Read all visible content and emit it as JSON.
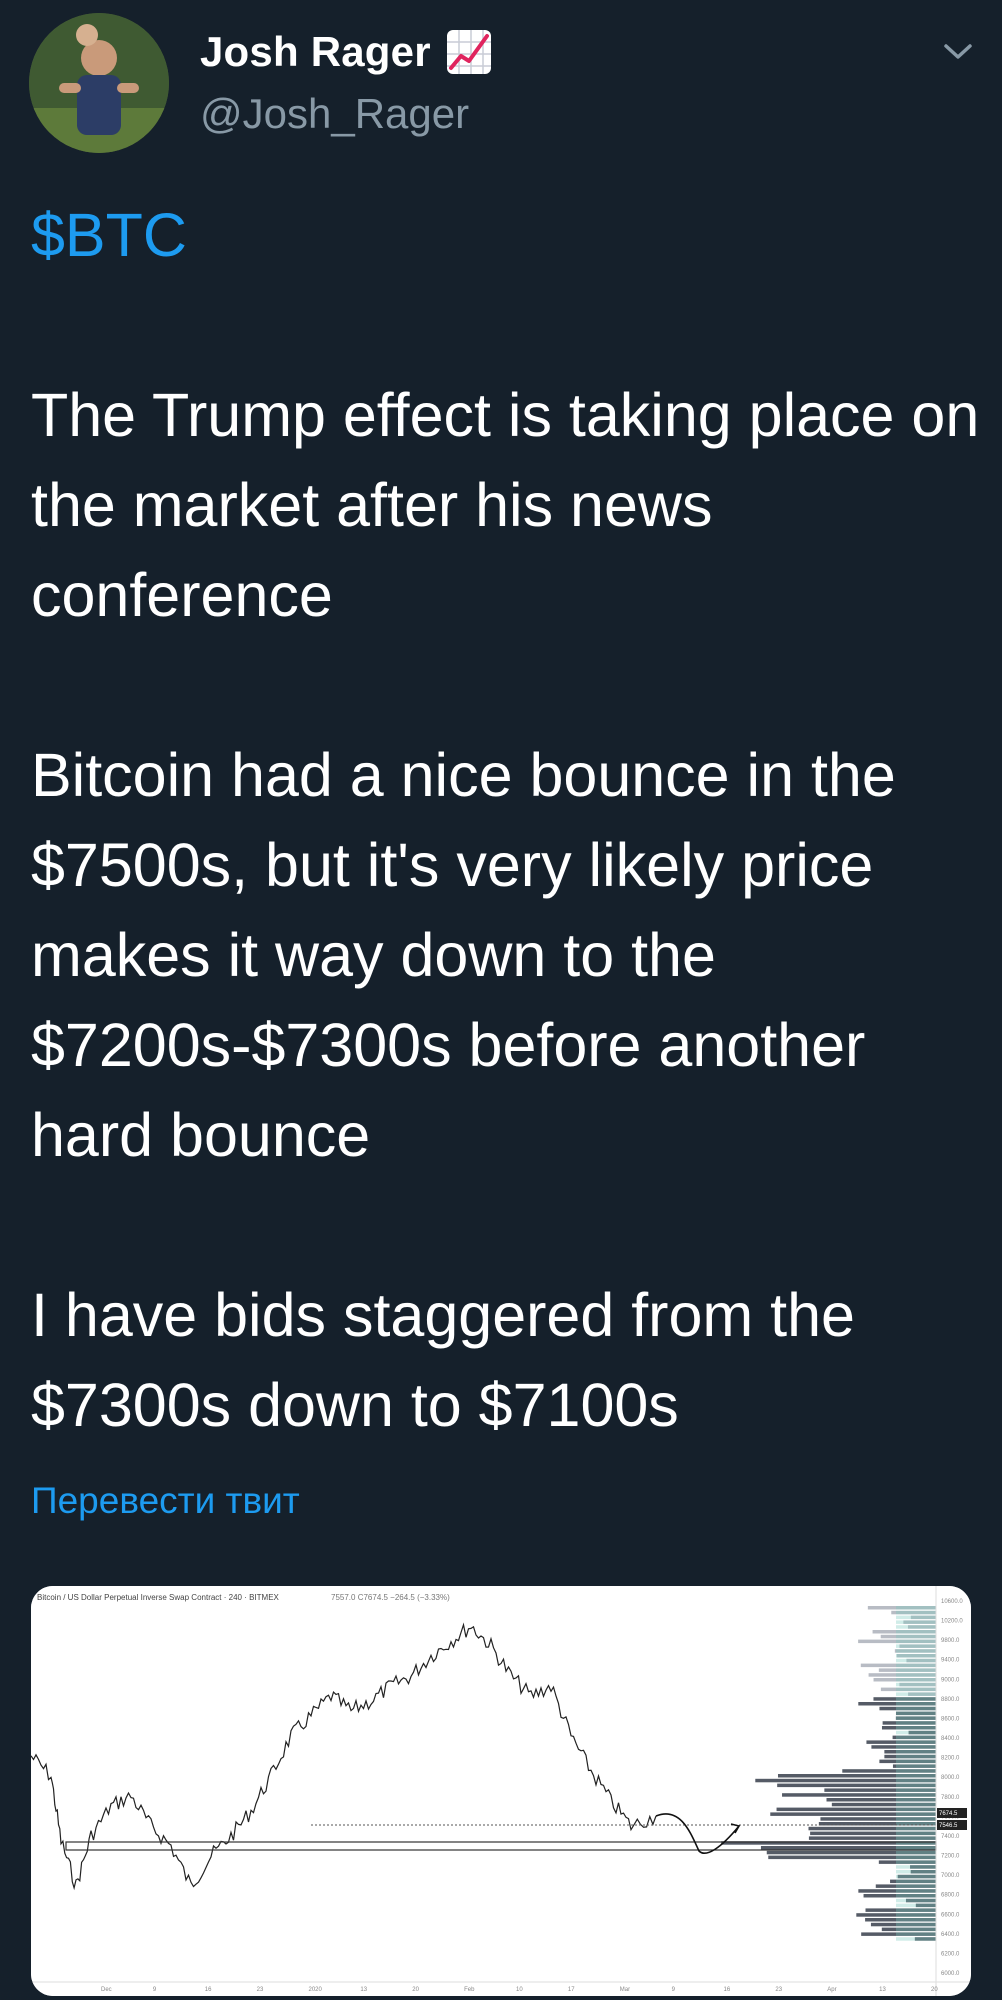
{
  "author": {
    "name": "Josh Rager",
    "handle": "@Josh_Rager",
    "badge_icon": "chart-increasing-emoji"
  },
  "tweet": {
    "cashtag": "$BTC",
    "paragraph_1": "The Trump effect is taking place on the market after his news conference",
    "paragraph_2": "Bitcoin had a nice bounce in the $7500s, but it's very likely price makes it way down to the $7200s-$7300s before another hard bounce",
    "paragraph_3": "I have bids staggered from the $7300s down to $7100s"
  },
  "translate_link": "Перевести твит",
  "colors": {
    "background": "#15202b",
    "link": "#1d9bf0",
    "muted": "#8899a6"
  },
  "attached_chart": {
    "header": "Bitcoin / US Dollar Perpetual Inverse Swap Contract · 240 · BITMEX",
    "ohlc": "7557.0 C7674.5 −264.5 (−3.33%)",
    "price_ticks": [
      "10600.0",
      "10200.0",
      "9800.0",
      "9400.0",
      "9000.0",
      "8800.0",
      "8600.0",
      "8400.0",
      "8200.0",
      "8000.0",
      "7800.0",
      "7600.0",
      "7400.0",
      "7200.0",
      "7000.0",
      "6800.0",
      "6600.0",
      "6400.0",
      "6200.0",
      "6000.0"
    ],
    "price_tags": [
      "7674.5",
      "7546.5"
    ],
    "date_ticks": [
      "Dec",
      "9",
      "16",
      "23",
      "2020",
      "13",
      "20",
      "Feb",
      "10",
      "17",
      "Mar",
      "9",
      "16",
      "23",
      "Apr",
      "13",
      "20"
    ]
  }
}
